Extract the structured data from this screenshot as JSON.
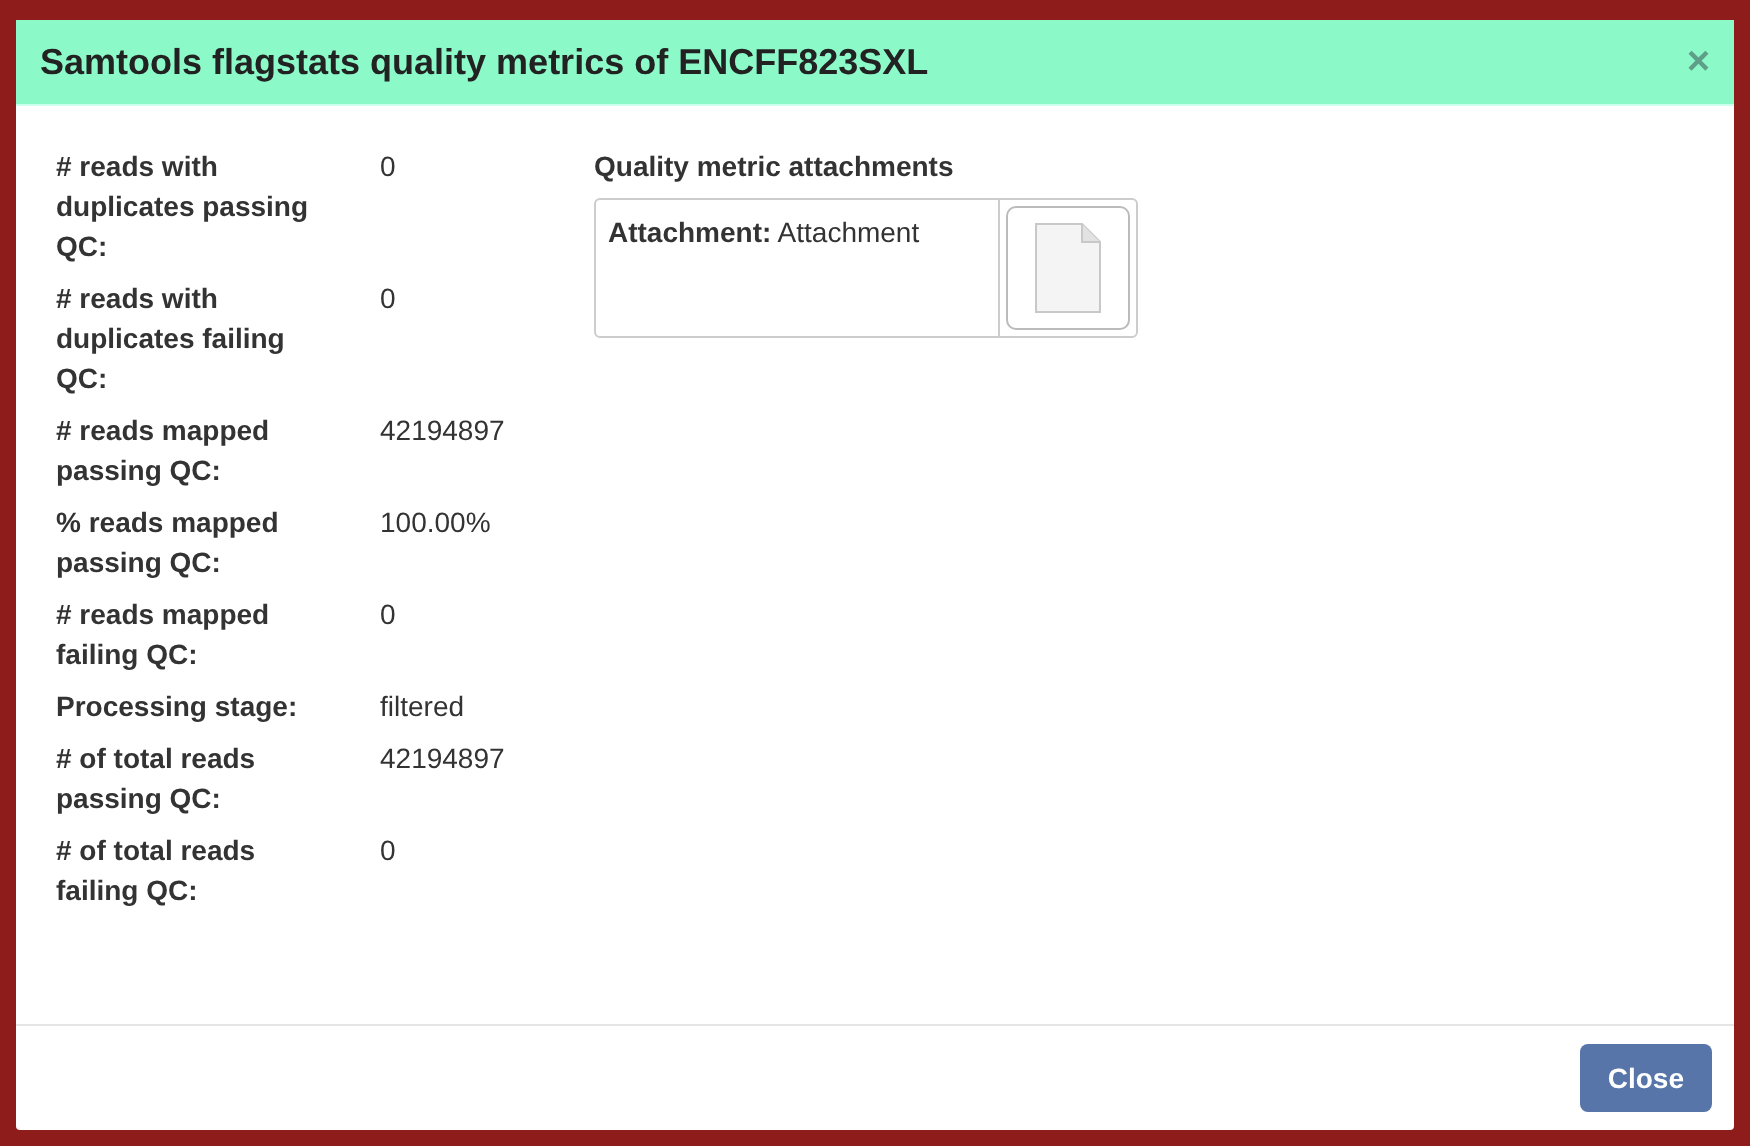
{
  "dialog": {
    "title": "Samtools flagstats quality metrics of ENCFF823SXL",
    "close_icon": "×"
  },
  "metrics": [
    {
      "label": "# reads with duplicates passing QC:",
      "value": "0"
    },
    {
      "label": "# reads with duplicates failing QC:",
      "value": "0"
    },
    {
      "label": "# reads mapped passing QC:",
      "value": "42194897"
    },
    {
      "label": "% reads mapped passing QC:",
      "value": "100.00%"
    },
    {
      "label": "# reads mapped failing QC:",
      "value": "0"
    },
    {
      "label": "Processing stage:",
      "value": "filtered"
    },
    {
      "label": "# of total reads passing QC:",
      "value": "42194897"
    },
    {
      "label": "# of total reads failing QC:",
      "value": "0"
    }
  ],
  "attachments": {
    "heading": "Quality metric attachments",
    "items": [
      {
        "text": "**Attachment:** Attachment"
      }
    ]
  },
  "footer": {
    "button": "Close"
  }
}
